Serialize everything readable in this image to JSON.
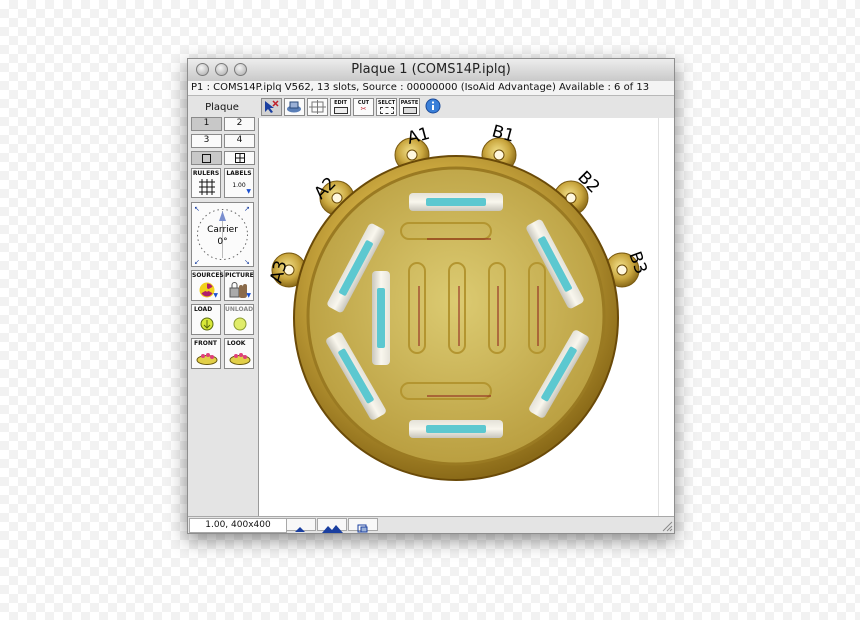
{
  "window": {
    "title": "Plaque 1 (COMS14P.iplq)",
    "info": "P1 : COMS14P.iplq V562, 13 slots, Source : 00000000 (IsoAid Advantage) Available : 6 of 13"
  },
  "left_panel": {
    "label": "Plaque",
    "view_buttons": [
      "1",
      "2",
      "3",
      "4"
    ],
    "tools": {
      "rulers": "RULERS",
      "labels": "LABELS",
      "labels_value": "1.00",
      "carrier": "Carrier",
      "carrier_angle": "0°",
      "sources": "SOURCES",
      "picture": "PICTURE",
      "load": "LOAD",
      "unload": "UNLOAD",
      "front": "FRONT",
      "look": "LOOK"
    }
  },
  "toolbar": {
    "edit": "EDIT",
    "cut": "CUT",
    "select": "SELCT",
    "paste": "PASTE",
    "info_icon": "info-icon"
  },
  "plaque": {
    "slot_labels": [
      "A1",
      "B1",
      "B2",
      "B3",
      "A2",
      "A3"
    ],
    "plaque_color": "#c8a640",
    "seed_color": "#5cc8d0"
  },
  "status": {
    "zoom": "1.00, 400x400"
  }
}
